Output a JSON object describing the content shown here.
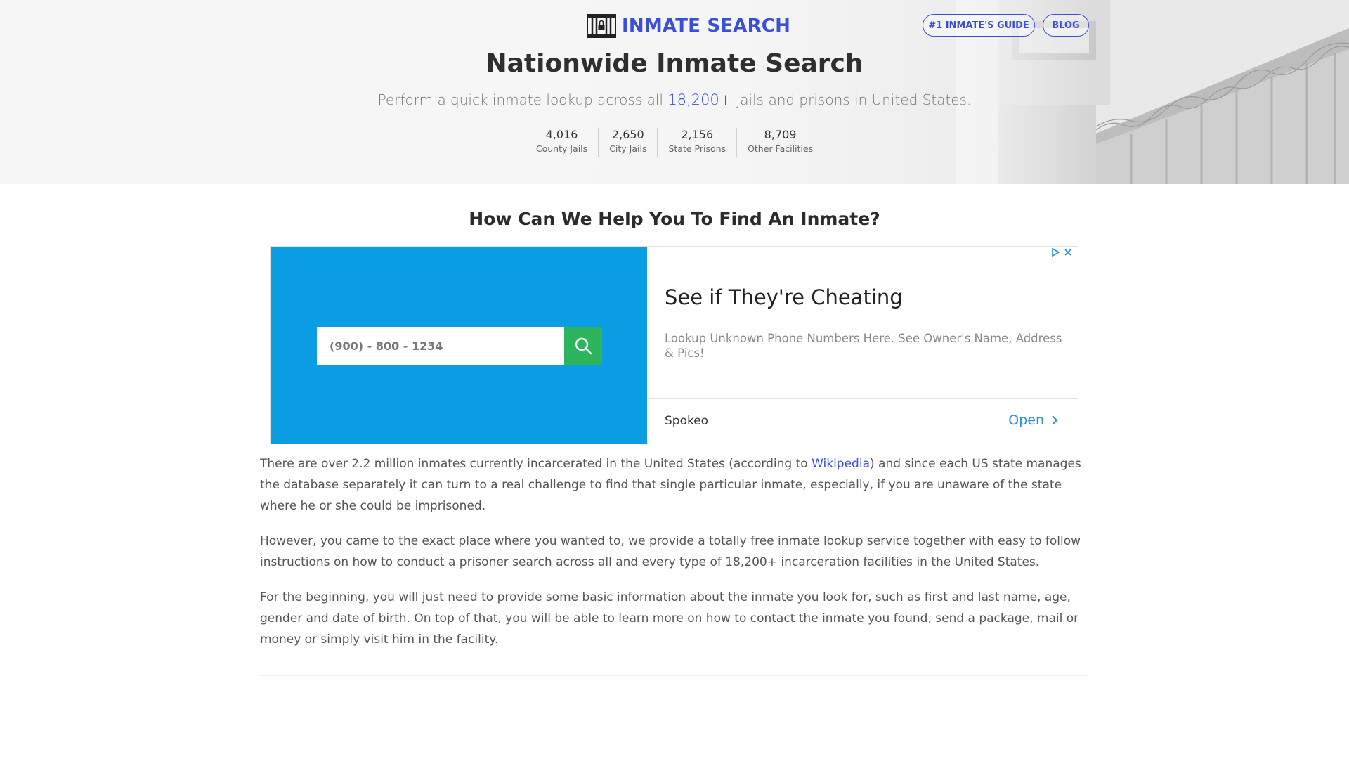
{
  "header": {
    "logo_text": "INMATE SEARCH",
    "nav": [
      {
        "label": "#1 INMATE'S GUIDE"
      },
      {
        "label": "BLOG"
      }
    ]
  },
  "hero": {
    "title": "Nationwide Inmate Search",
    "subtitle_pre": "Perform a quick inmate lookup across all ",
    "subtitle_highlight": "18,200+",
    "subtitle_post": " jails and prisons in United States.",
    "stats": [
      {
        "value": "4,016",
        "label": "County Jails"
      },
      {
        "value": "2,650",
        "label": "City Jails"
      },
      {
        "value": "2,156",
        "label": "State Prisons"
      },
      {
        "value": "8,709",
        "label": "Other Facilities"
      }
    ]
  },
  "section": {
    "title": "How Can We Help You To Find An Inmate?"
  },
  "ad": {
    "input_placeholder": "(900) - 800 - 1234",
    "headline": "See if They're Cheating",
    "body": "Lookup Unknown Phone Numbers Here. See Owner's Name, Address & Pics!",
    "brand": "Spokeo",
    "cta": "Open",
    "colors": {
      "panel": "#0a9de3",
      "button": "#2db55d",
      "link": "#2b8ce6"
    }
  },
  "paragraphs": {
    "p1_pre": "There are over 2.2 million inmates currently incarcerated in the United States (according to ",
    "p1_link": "Wikipedia",
    "p1_post": ") and since each US state manages the database separately it can turn to a real challenge to find that single particular inmate, especially, if you are unaware of the state where he or she could be imprisoned.",
    "p2": "However, you came to the exact place where you wanted to, we provide a totally free inmate lookup service together with easy to follow instructions on how to conduct a prisoner search across all and every type of 18,200+ incarceration facilities in the United States.",
    "p3": "For the beginning, you will just need to provide some basic information about the inmate you look for, such as first and last name, age, gender and date of birth. On top of that, you will be able to learn more on how to contact the inmate you found, send a package, mail or money or simply visit him in the facility."
  },
  "colors": {
    "brand": "#3b4fd6"
  }
}
